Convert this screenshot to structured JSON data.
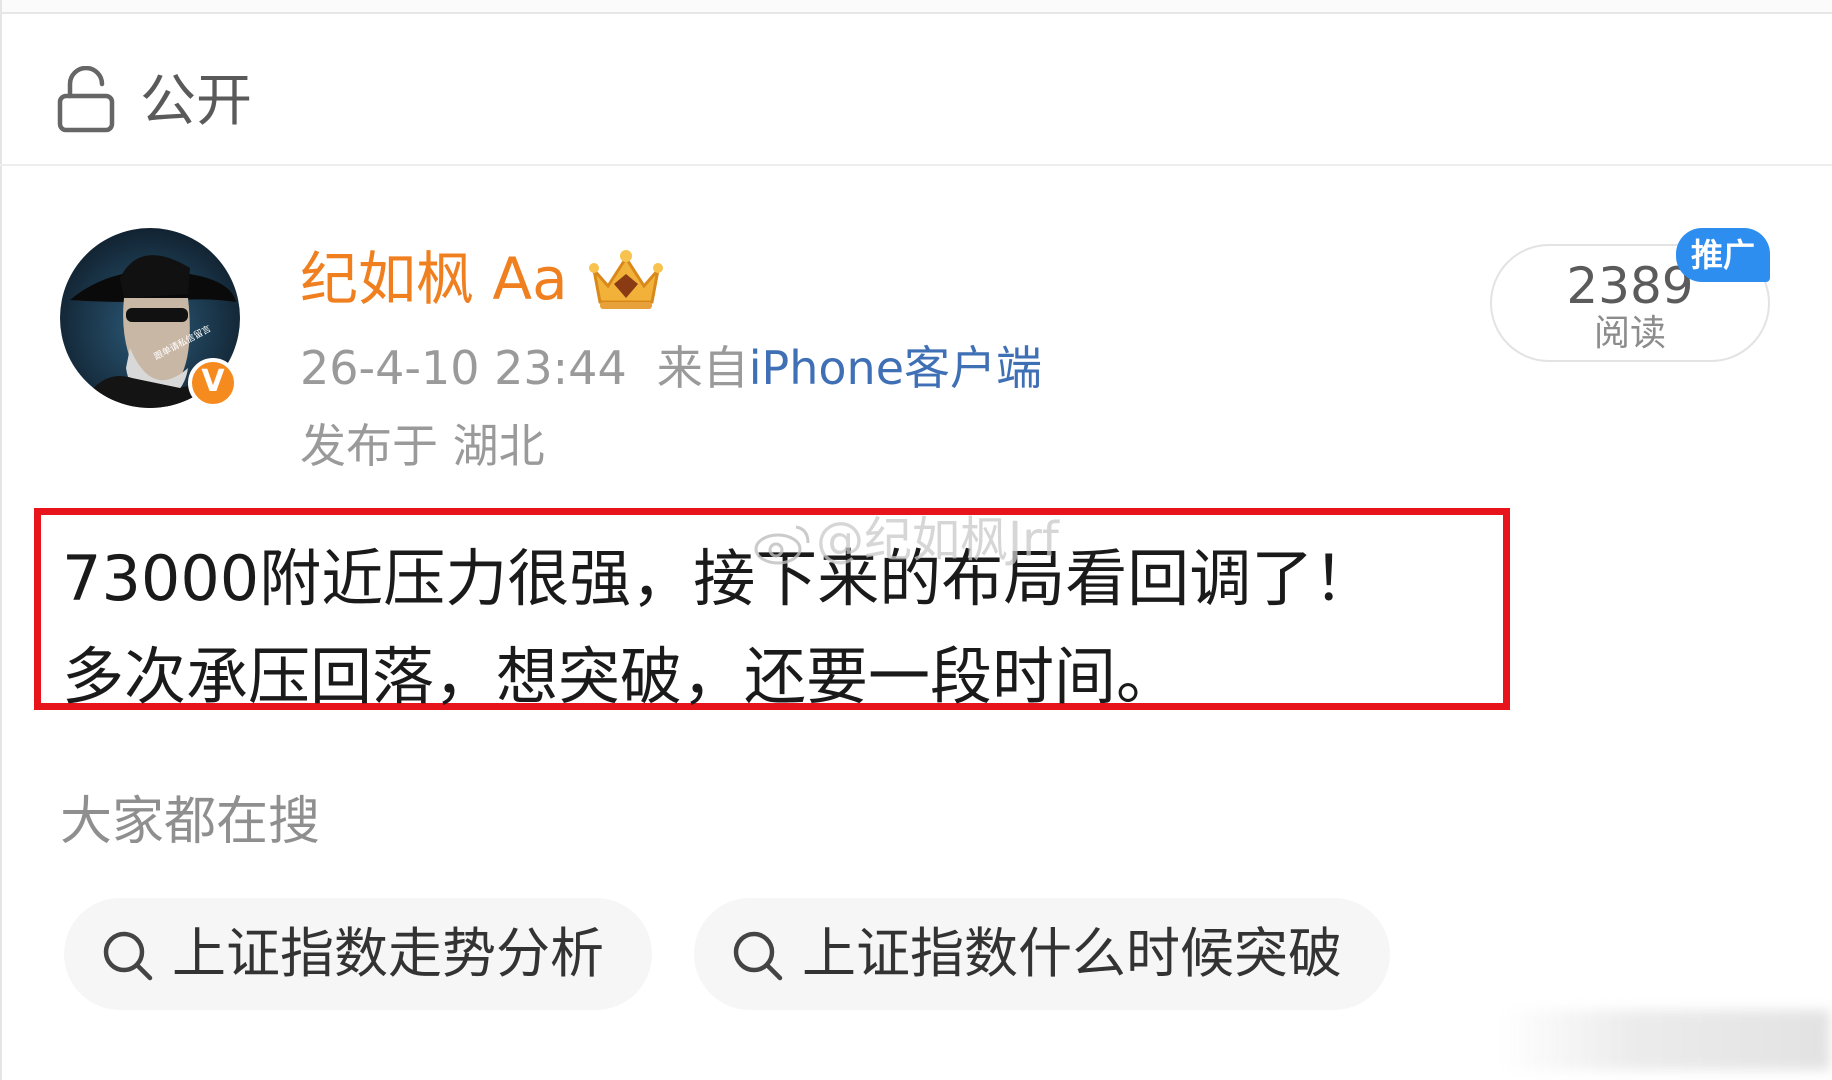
{
  "visibility": {
    "label": "公开",
    "icon": "unlock-icon"
  },
  "author": {
    "name": "纪如枫 Aa",
    "verified_mark": "V",
    "avatar_icon": "avatar-man-sunglasses-hat",
    "vip_icon": "crown-icon",
    "avatar_caption": "跟单请私信留言"
  },
  "post": {
    "timestamp": "26-4-10 23:44",
    "source_prefix": "来自",
    "source_app": "iPhone客户端",
    "location": "发布于 湖北",
    "lines": [
      "73000附近压力很强，接下来的布局看回调了！",
      "多次承压回落，想突破，还要一段时间。"
    ],
    "watermark": "@纪如枫Jrf"
  },
  "reads": {
    "count": "2389",
    "label": "阅读",
    "promo_badge": "推广"
  },
  "trending": {
    "heading": "大家都在搜",
    "chips": [
      {
        "label": "上证指数走势分析",
        "icon": "search-icon"
      },
      {
        "label": "上证指数什么时候突破",
        "icon": "search-icon"
      }
    ]
  },
  "colors": {
    "username": "#f07f20",
    "source_app": "#3f6fb5",
    "highlight_border": "#e8141b",
    "promo_badge": "#2e8ef0",
    "verified_badge": "#f58a1f"
  }
}
